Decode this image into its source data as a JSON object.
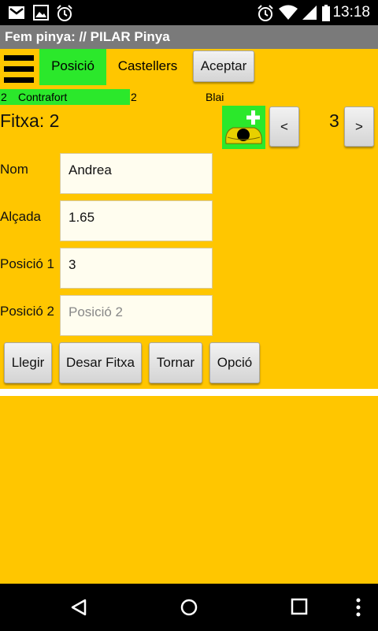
{
  "status_bar": {
    "time": "13:18",
    "icons": [
      "gmail-icon",
      "image-icon",
      "alarm-icon",
      "alarm-icon",
      "wifi-icon",
      "signal-icon",
      "battery-icon"
    ]
  },
  "title_bar": {
    "title": "Fem pinya: // PILAR Pinya"
  },
  "tabs": {
    "posicio": "Posició",
    "castellers": "Castellers"
  },
  "buttons": {
    "aceptar": "Aceptar",
    "prev": "<",
    "next": ">",
    "llegir": "Llegir",
    "desar": "Desar Fitxa",
    "tornar": "Tornar",
    "opcio": "Opció"
  },
  "info_row": {
    "number": "2",
    "position": "Contrafort",
    "number2": "2",
    "name": "Blai"
  },
  "fitxa": {
    "label": "Fitxa: 2",
    "counter": "3"
  },
  "form": {
    "nom": {
      "label": "Nom",
      "value": "Andrea"
    },
    "alcada": {
      "label": "Alçada",
      "value": "1.65"
    },
    "posicio1": {
      "label": "Posició 1",
      "value": "3"
    },
    "posicio2": {
      "label": "Posició 2",
      "placeholder": "Posició 2"
    }
  },
  "colors": {
    "background": "#FFC600",
    "accent_green": "#2BE82B",
    "title_bar": "#7A7A7A"
  }
}
